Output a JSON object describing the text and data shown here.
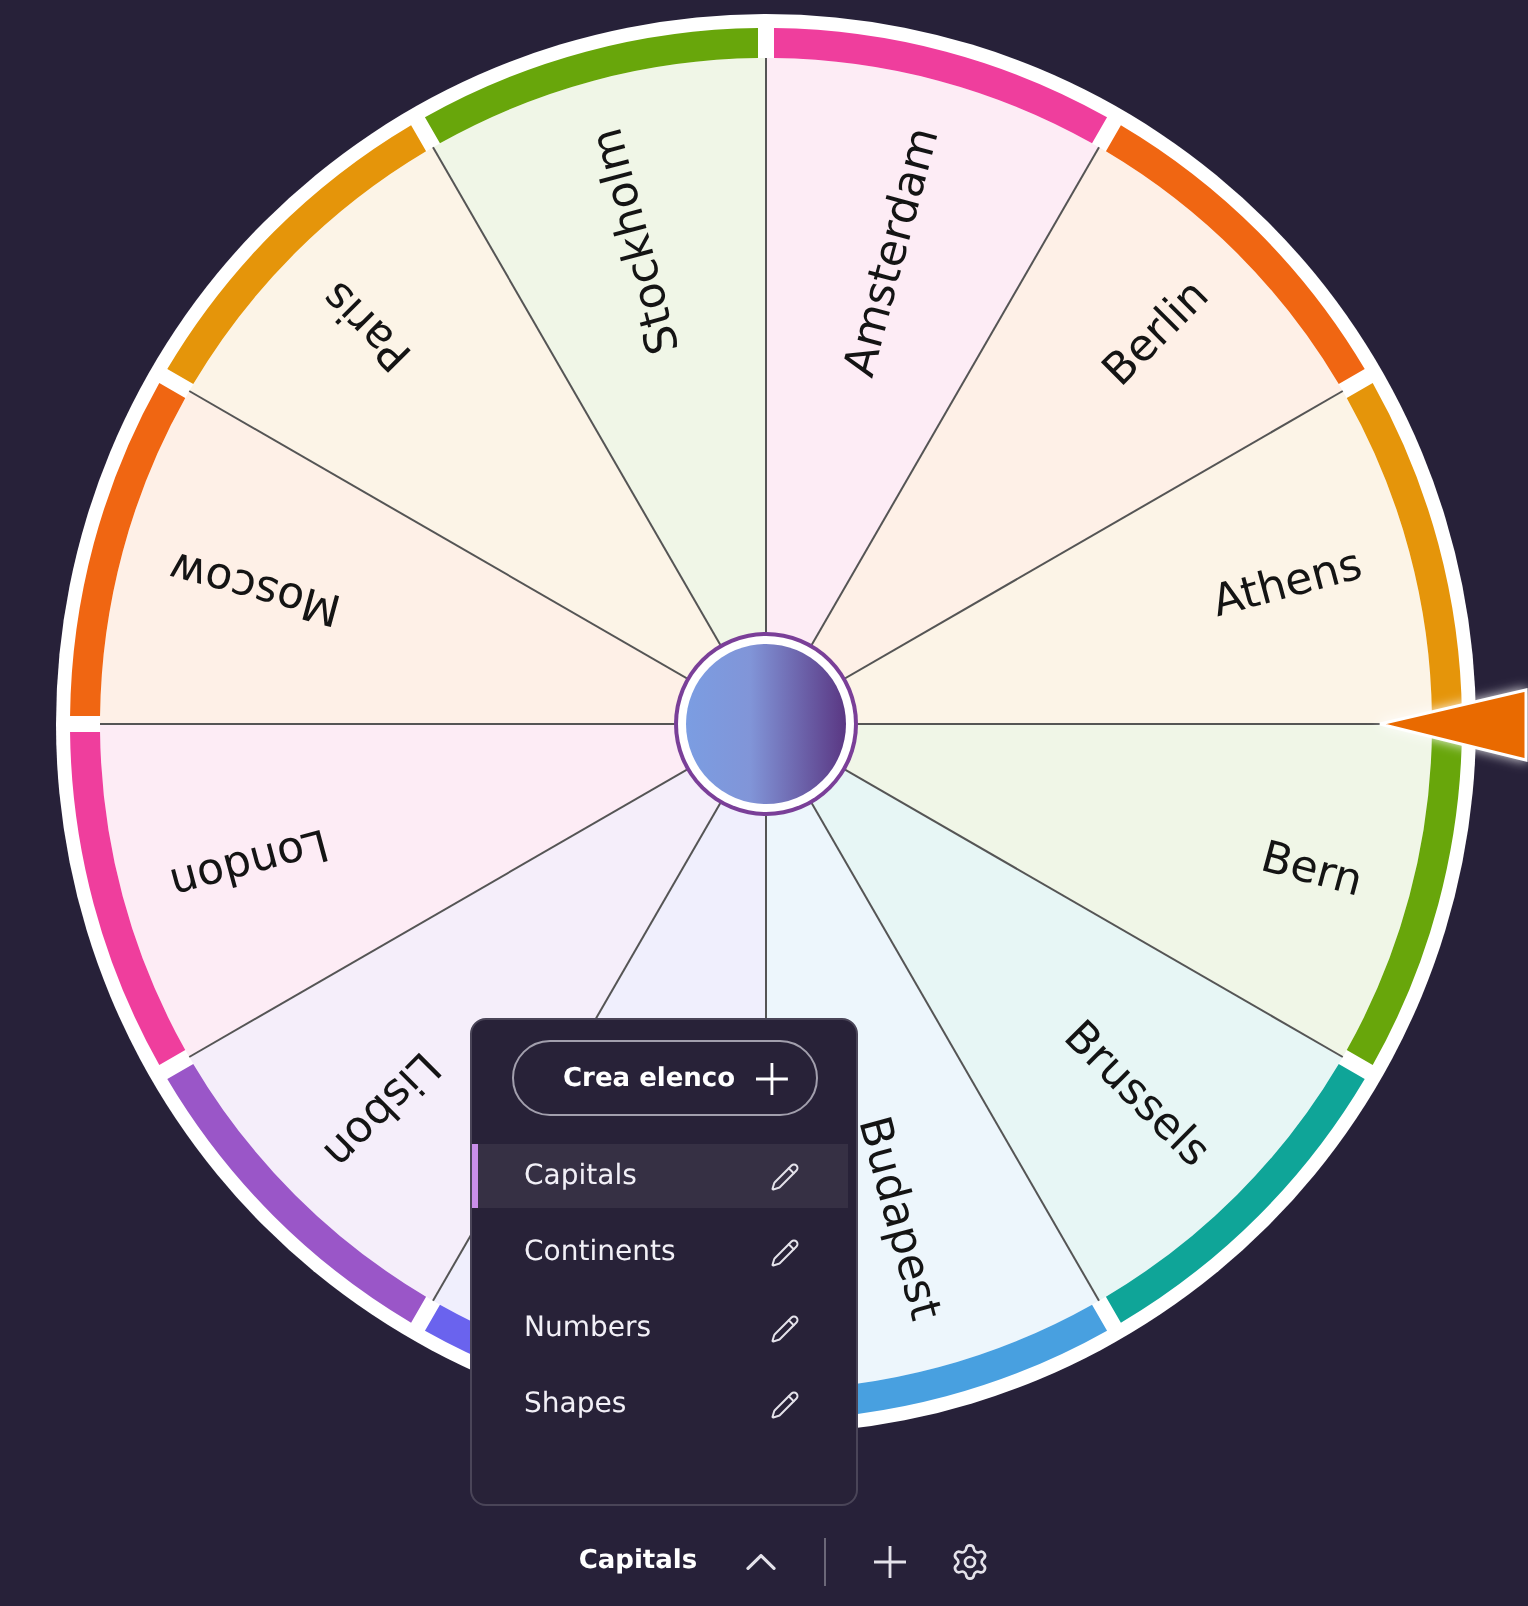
{
  "wheel": {
    "segments": [
      {
        "label": "Amsterdam",
        "color": "#ef3e9d"
      },
      {
        "label": "Berlin",
        "color": "#f06612"
      },
      {
        "label": "Athens",
        "color": "#e5950a"
      },
      {
        "label": "Bern",
        "color": "#68a60b"
      },
      {
        "label": "Brussels",
        "color": "#0fa598"
      },
      {
        "label": "Budapest",
        "color": "#48a0e0"
      },
      {
        "color": "#6a63ee"
      },
      {
        "label": "Lisbon",
        "color": "#9a56c8"
      },
      {
        "label": "London",
        "color": "#ef3e9d"
      },
      {
        "label": "Moscow",
        "color": "#f06612"
      },
      {
        "label": "Paris",
        "color": "#e5950a"
      },
      {
        "label": "Stockholm",
        "color": "#68a60b"
      }
    ]
  },
  "menu": {
    "create_button": "Crea elenco",
    "lists": [
      {
        "label": "Capitals",
        "selected": true
      },
      {
        "label": "Continents",
        "selected": false
      },
      {
        "label": "Numbers",
        "selected": false
      },
      {
        "label": "Shapes",
        "selected": false
      }
    ]
  },
  "bottom_bar": {
    "current_list": "Capitals"
  }
}
